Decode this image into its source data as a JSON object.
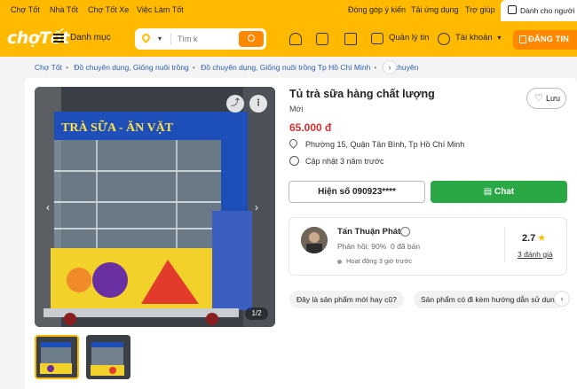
{
  "topbar": {
    "links": [
      "Chợ Tốt",
      "Nhà Tốt",
      "Chợ Tốt Xe",
      "Việc Làm Tốt"
    ],
    "right_links": [
      "Đóng góp ý kiến",
      "Tải ứng dụng",
      "Trợ giúp"
    ],
    "seller_label": "Dành cho người bán"
  },
  "header": {
    "logo": "chợTốt",
    "menu_label": "Danh mục",
    "search_placeholder": "Tìm k",
    "manage_label": "Quản lý tin",
    "account_label": "Tài khoản",
    "post_label": "ĐĂNG TIN"
  },
  "breadcrumb": [
    "Chợ Tốt",
    "Đồ chuyên dụng, Giống nuôi trồng",
    "Đồ chuyên dụng, Giống nuôi trồng Tp Hồ Chí Minh",
    "Đồ chuyên"
  ],
  "gallery": {
    "counter": "1/2",
    "sign_text": "TRÀ SỮA - ĂN VẶT",
    "thumb_count": 2,
    "active_thumb": 1
  },
  "listing": {
    "title": "Tủ trà sữa hàng chất lượng",
    "condition": "Mới",
    "price": "65.000 đ",
    "location": "Phường 15, Quận Tân Bình, Tp Hồ Chí Minh",
    "updated": "Cập nhật 3 năm trước",
    "save_label": "Lưu",
    "phone_label": "Hiện số 090923****",
    "chat_label": "Chat"
  },
  "seller": {
    "name": "Tấn Thuận Phát",
    "reply_rate": "Phản hồi: 90%",
    "sold": "0 đã bán",
    "active": "Hoạt động 3 giờ trước",
    "rating": "2.7",
    "reviews": "3 đánh giá"
  },
  "questions": [
    "Đây là sản phẩm mới hay cũ?",
    "Sản phẩm có đi kèm hướng dẫn sử dụng không?"
  ],
  "colors": {
    "brand": "#ffba00",
    "action": "#ff8800",
    "price": "#d32f2f",
    "chat": "#29a745"
  }
}
